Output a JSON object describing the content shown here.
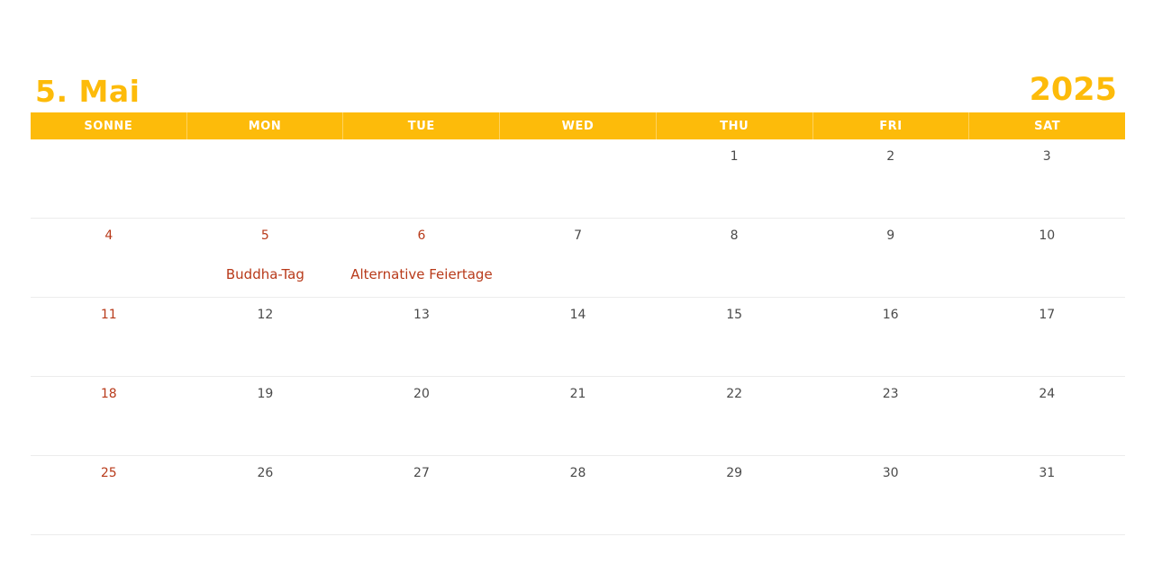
{
  "header": {
    "month_title": "5. Mai",
    "year": "2025"
  },
  "weekdays": [
    "SONNE",
    "MON",
    "TUE",
    "WED",
    "THU",
    "FRI",
    "SAT"
  ],
  "weeks": [
    [
      {
        "day": "",
        "holiday": false,
        "event": ""
      },
      {
        "day": "",
        "holiday": false,
        "event": ""
      },
      {
        "day": "",
        "holiday": false,
        "event": ""
      },
      {
        "day": "",
        "holiday": false,
        "event": ""
      },
      {
        "day": "1",
        "holiday": false,
        "event": ""
      },
      {
        "day": "2",
        "holiday": false,
        "event": ""
      },
      {
        "day": "3",
        "holiday": false,
        "event": ""
      }
    ],
    [
      {
        "day": "4",
        "holiday": true,
        "event": ""
      },
      {
        "day": "5",
        "holiday": true,
        "event": "Buddha-Tag"
      },
      {
        "day": "6",
        "holiday": true,
        "event": "Alternative Feiertage"
      },
      {
        "day": "7",
        "holiday": false,
        "event": ""
      },
      {
        "day": "8",
        "holiday": false,
        "event": ""
      },
      {
        "day": "9",
        "holiday": false,
        "event": ""
      },
      {
        "day": "10",
        "holiday": false,
        "event": ""
      }
    ],
    [
      {
        "day": "11",
        "holiday": true,
        "event": ""
      },
      {
        "day": "12",
        "holiday": false,
        "event": ""
      },
      {
        "day": "13",
        "holiday": false,
        "event": ""
      },
      {
        "day": "14",
        "holiday": false,
        "event": ""
      },
      {
        "day": "15",
        "holiday": false,
        "event": ""
      },
      {
        "day": "16",
        "holiday": false,
        "event": ""
      },
      {
        "day": "17",
        "holiday": false,
        "event": ""
      }
    ],
    [
      {
        "day": "18",
        "holiday": true,
        "event": ""
      },
      {
        "day": "19",
        "holiday": false,
        "event": ""
      },
      {
        "day": "20",
        "holiday": false,
        "event": ""
      },
      {
        "day": "21",
        "holiday": false,
        "event": ""
      },
      {
        "day": "22",
        "holiday": false,
        "event": ""
      },
      {
        "day": "23",
        "holiday": false,
        "event": ""
      },
      {
        "day": "24",
        "holiday": false,
        "event": ""
      }
    ],
    [
      {
        "day": "25",
        "holiday": true,
        "event": ""
      },
      {
        "day": "26",
        "holiday": false,
        "event": ""
      },
      {
        "day": "27",
        "holiday": false,
        "event": ""
      },
      {
        "day": "28",
        "holiday": false,
        "event": ""
      },
      {
        "day": "29",
        "holiday": false,
        "event": ""
      },
      {
        "day": "30",
        "holiday": false,
        "event": ""
      },
      {
        "day": "31",
        "holiday": false,
        "event": ""
      }
    ]
  ],
  "colors": {
    "accent": "#FDBB0A",
    "holiday": "#B83A1A",
    "text": "#4A4A4A"
  }
}
